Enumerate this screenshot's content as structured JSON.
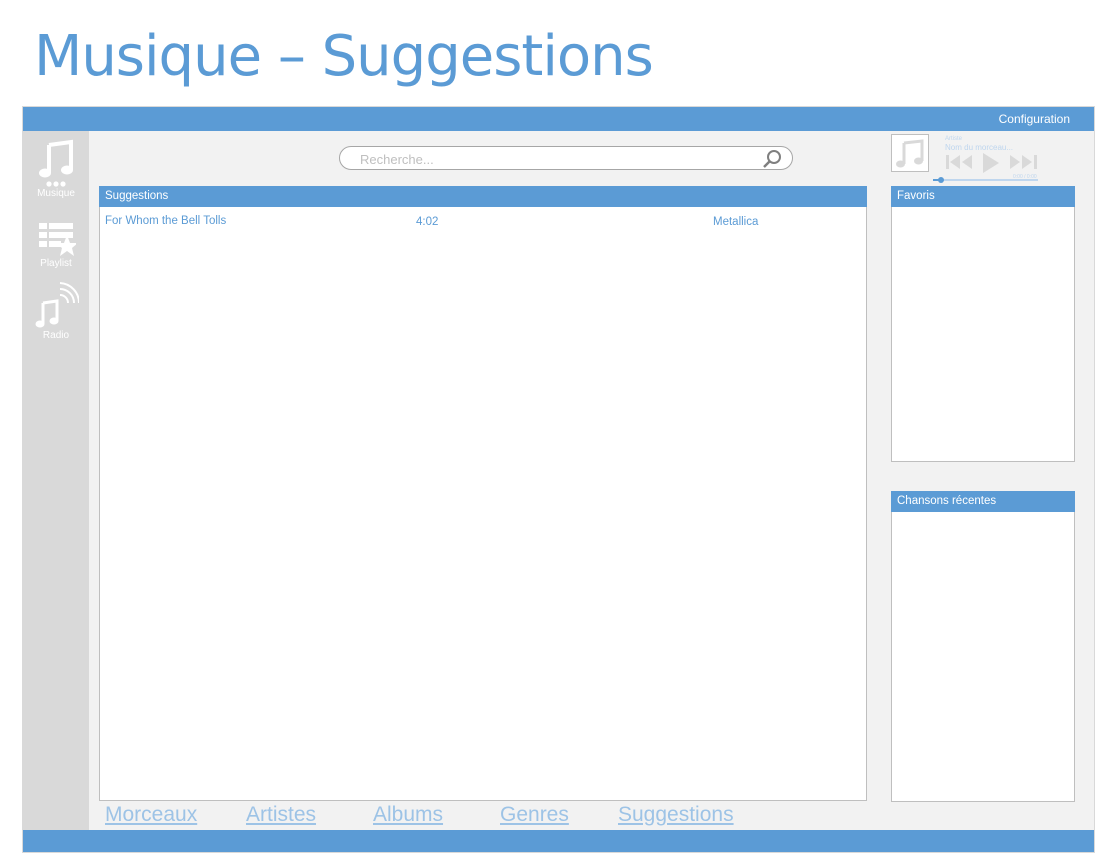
{
  "page_title": "Musique – Suggestions",
  "header": {
    "configuration_label": "Configuration"
  },
  "sidebar": {
    "items": [
      {
        "label": "Musique",
        "icon": "music-note-icon"
      },
      {
        "label": "Playlist",
        "icon": "playlist-star-icon"
      },
      {
        "label": "Radio",
        "icon": "radio-waves-icon"
      }
    ]
  },
  "search": {
    "placeholder": "Recherche...",
    "value": ""
  },
  "player": {
    "artist": "Artiste",
    "track": "Nom du morceau...",
    "time": "0:00 / 0:00",
    "progress": 0.08
  },
  "suggestions": {
    "header": "Suggestions",
    "rows": [
      {
        "title": "For Whom the Bell Tolls",
        "duration": "4:02",
        "artist": "Metallica"
      }
    ]
  },
  "favoris": {
    "header": "Favoris"
  },
  "recentes": {
    "header": "Chansons récentes"
  },
  "tabs": [
    "Morceaux",
    "Artistes",
    "Albums",
    "Genres",
    "Suggestions"
  ],
  "colors": {
    "accent": "#5b9bd5",
    "tab_link": "#9dc3e6",
    "sidebar": "#d9d9d9",
    "background": "#f2f2f2"
  }
}
